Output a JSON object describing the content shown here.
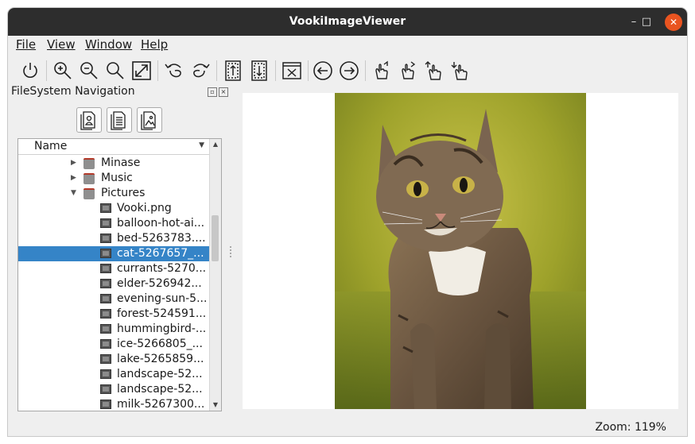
{
  "window": {
    "title": "VookiImageViewer",
    "minimize": "–",
    "maximize": "□",
    "close": "✕"
  },
  "menu": {
    "file": "File",
    "view": "View",
    "window": "Window",
    "help": "Help"
  },
  "toolbar": {
    "icons": [
      "power-icon",
      "zoom-in-icon",
      "zoom-out-icon",
      "zoom-reset-icon",
      "fit-window-icon",
      "rotate-left-icon",
      "rotate-right-icon",
      "flip-vertical-icon",
      "flip-horizontal-icon",
      "full-screen-icon",
      "previous-icon",
      "next-icon",
      "scroll-up-icon",
      "scroll-down-icon",
      "scroll-left-icon",
      "scroll-right-icon"
    ]
  },
  "dock": {
    "title": "FileSystem Navigation",
    "float": "▫",
    "close": "×"
  },
  "tree": {
    "header": "Name",
    "rows": [
      {
        "label": "Minase",
        "type": "folder",
        "expanded": false
      },
      {
        "label": "Music",
        "type": "folder",
        "expanded": false
      },
      {
        "label": "Pictures",
        "type": "folder",
        "expanded": true
      },
      {
        "label": "Vooki.png",
        "type": "image"
      },
      {
        "label": "balloon-hot-ai...",
        "type": "image"
      },
      {
        "label": "bed-5263783....",
        "type": "image"
      },
      {
        "label": "cat-5267657_...",
        "type": "image",
        "selected": true
      },
      {
        "label": "currants-5270...",
        "type": "image"
      },
      {
        "label": "elder-526942...",
        "type": "image"
      },
      {
        "label": "evening-sun-5...",
        "type": "image"
      },
      {
        "label": "forest-524591...",
        "type": "image"
      },
      {
        "label": "hummingbird-...",
        "type": "image"
      },
      {
        "label": "ice-5266805_...",
        "type": "image"
      },
      {
        "label": "lake-5265859...",
        "type": "image"
      },
      {
        "label": "landscape-52...",
        "type": "image"
      },
      {
        "label": "landscape-52...",
        "type": "image"
      },
      {
        "label": "milk-5267300...",
        "type": "image"
      }
    ]
  },
  "status": {
    "zoom": "Zoom: 119%"
  },
  "colors": {
    "titlebar": "#2d2d2d",
    "close": "#e95420",
    "selection": "#3584c7"
  }
}
